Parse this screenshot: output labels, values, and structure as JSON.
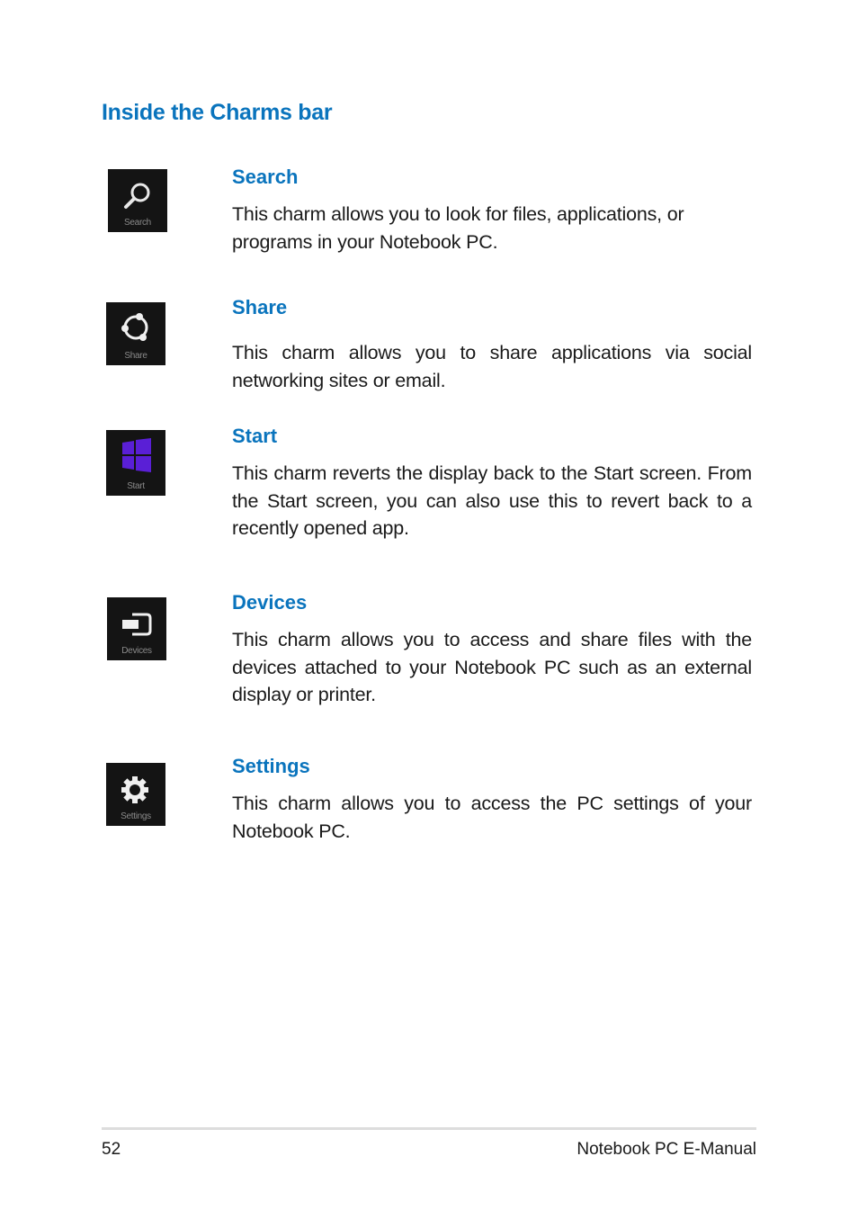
{
  "page": {
    "title": "Inside the Charms bar"
  },
  "charms": [
    {
      "tile_label": "Search",
      "icon": "search-icon",
      "heading": "Search",
      "description": "This charm allows you to look for files, applications, or programs in your Notebook PC."
    },
    {
      "tile_label": "Share",
      "icon": "share-icon",
      "heading": "Share",
      "description": "This charm allows you to share applications via social networking sites or email."
    },
    {
      "tile_label": "Start",
      "icon": "windows-logo-icon",
      "heading": "Start",
      "description": "This charm reverts the display back to the Start screen. From the Start screen, you can also use this to revert back to a recently opened app."
    },
    {
      "tile_label": "Devices",
      "icon": "devices-icon",
      "heading": "Devices",
      "description": "This charm allows you to access and share files with the devices attached to your Notebook PC such as an external display or printer."
    },
    {
      "tile_label": "Settings",
      "icon": "gear-icon",
      "heading": "Settings",
      "description": "This charm allows you to access the PC settings of your Notebook PC."
    }
  ],
  "colors": {
    "heading_blue": "#0a74bd",
    "tile_bg": "#141414",
    "start_purple": "#5a1fd6"
  },
  "footer": {
    "page_number": "52",
    "manual_title": "Notebook PC E-Manual"
  }
}
